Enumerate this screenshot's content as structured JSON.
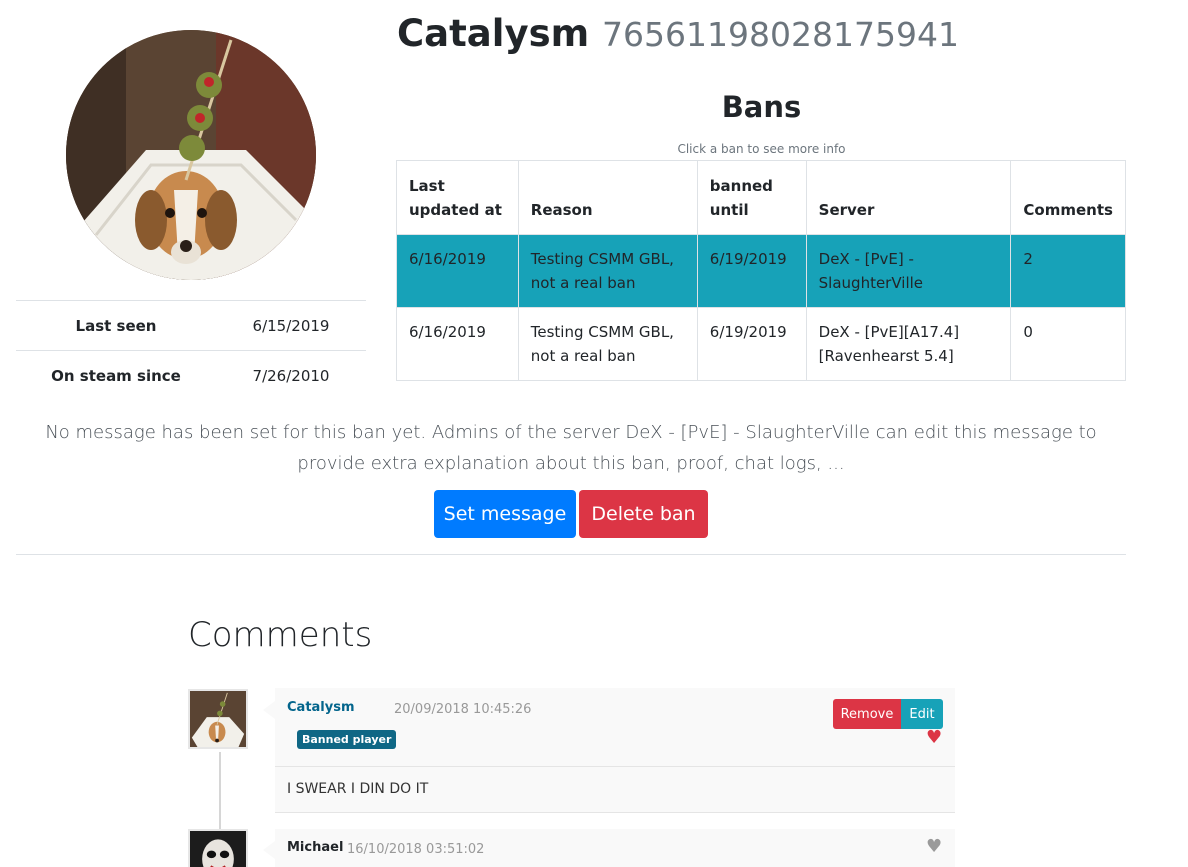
{
  "profile": {
    "name": "Catalysm",
    "steam_id": "76561198028175941",
    "stats": [
      {
        "label": "Last seen",
        "value": "6/15/2019"
      },
      {
        "label": "On steam since",
        "value": "7/26/2010"
      }
    ]
  },
  "bans": {
    "heading": "Bans",
    "hint": "Click a ban to see more info",
    "columns": [
      "Last updated at",
      "Reason",
      "banned until",
      "Server",
      "Comments"
    ],
    "rows": [
      {
        "updated": "6/16/2019",
        "reason": "Testing CSMM GBL, not a real ban",
        "until": "6/19/2019",
        "server": "DeX - [PvE] - SlaughterVille",
        "comments": "2"
      },
      {
        "updated": "6/16/2019",
        "reason": "Testing CSMM GBL, not a real ban",
        "until": "6/19/2019",
        "server": "DeX - [PvE][A17.4][Ravenhearst 5.4]",
        "comments": "0"
      }
    ],
    "selected_color": "#17a2b8"
  },
  "ban_message": "No message has been set for this ban yet. Admins of the server DeX - [PvE] - SlaughterVille can edit this message to provide extra explanation about this ban, proof, chat logs, ...",
  "actions": {
    "set_message": "Set message",
    "delete_ban": "Delete ban"
  },
  "comments": {
    "heading": "Comments",
    "items": [
      {
        "author": "Catalysm",
        "date": "20/09/2018 10:45:26",
        "badge": "Banned player",
        "text": "I SWEAR I DIN DO IT",
        "remove_label": "Remove",
        "edit_label": "Edit",
        "heart_icon": "heart-icon",
        "liked": true
      },
      {
        "author": "Michael",
        "date": "16/10/2018 03:51:02",
        "heart_icon": "heart-icon",
        "liked": false
      }
    ]
  },
  "colors": {
    "primary": "#007bff",
    "danger": "#dc3545",
    "info": "#17a2b8",
    "badge": "#0f6785"
  }
}
